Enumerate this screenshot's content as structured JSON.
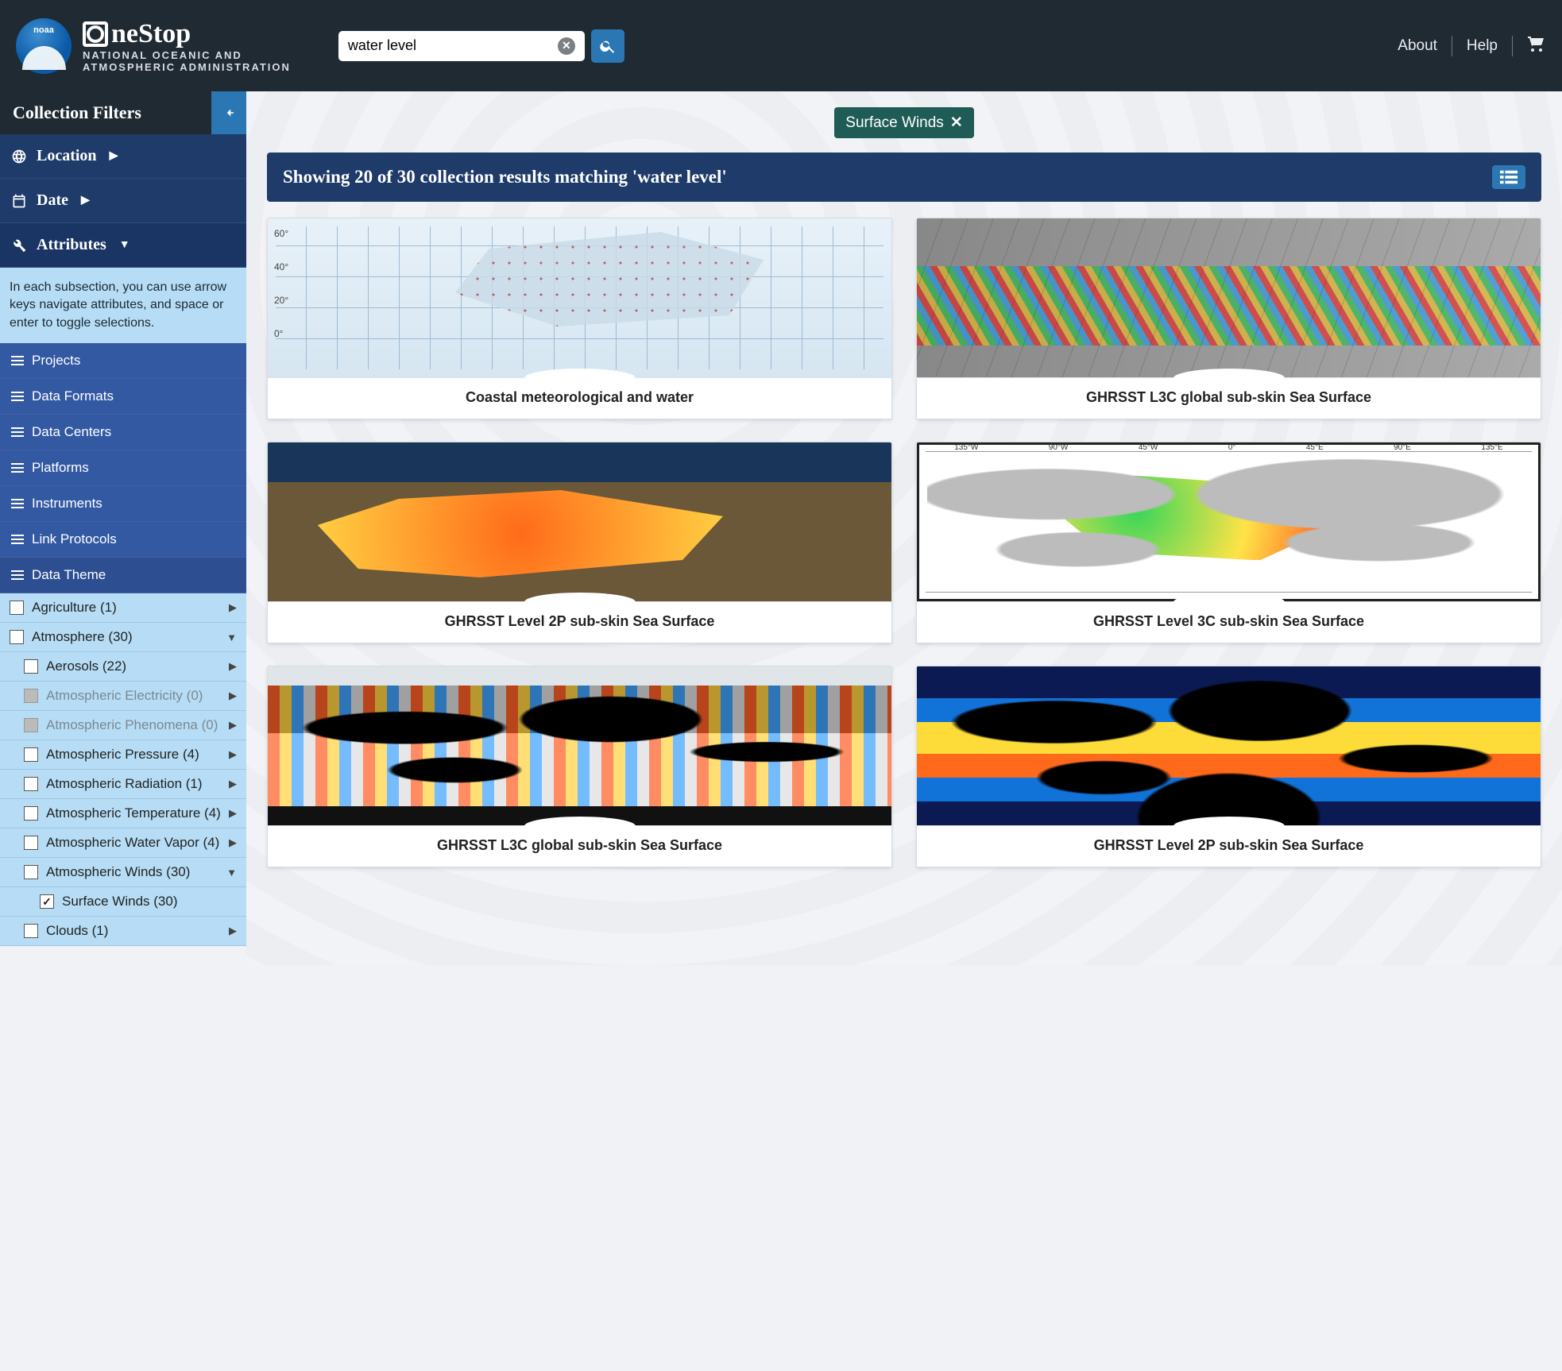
{
  "header": {
    "noaa_abbr": "noaa",
    "brand_name": "neStop",
    "brand_sub1": "NATIONAL OCEANIC AND",
    "brand_sub2": "ATMOSPHERIC ADMINISTRATION",
    "search_value": "water level",
    "links": {
      "about": "About",
      "help": "Help"
    }
  },
  "sidebar": {
    "title": "Collection Filters",
    "sections": {
      "location": "Location",
      "date": "Date",
      "attributes": "Attributes"
    },
    "help_text": "In each subsection, you can use arrow keys navigate attributes, and space or enter to toggle selections.",
    "subs": [
      "Projects",
      "Data Formats",
      "Data Centers",
      "Platforms",
      "Instruments",
      "Link Protocols",
      "Data Theme"
    ],
    "themes": [
      {
        "label": "Agriculture (1)",
        "level": 0,
        "checked": false,
        "disabled": false,
        "arrow": "▶"
      },
      {
        "label": "Atmosphere (30)",
        "level": 0,
        "checked": false,
        "disabled": false,
        "arrow": "▼"
      },
      {
        "label": "Aerosols (22)",
        "level": 1,
        "checked": false,
        "disabled": false,
        "arrow": "▶"
      },
      {
        "label": "Atmospheric Electricity (0)",
        "level": 1,
        "checked": false,
        "disabled": true,
        "arrow": "▶"
      },
      {
        "label": "Atmospheric Phenomena (0)",
        "level": 1,
        "checked": false,
        "disabled": true,
        "arrow": "▶"
      },
      {
        "label": "Atmospheric Pressure (4)",
        "level": 1,
        "checked": false,
        "disabled": false,
        "arrow": "▶"
      },
      {
        "label": "Atmospheric Radiation (1)",
        "level": 1,
        "checked": false,
        "disabled": false,
        "arrow": "▶"
      },
      {
        "label": "Atmospheric Temperature (4)",
        "level": 1,
        "checked": false,
        "disabled": false,
        "arrow": "▶"
      },
      {
        "label": "Atmospheric Water Vapor (4)",
        "level": 1,
        "checked": false,
        "disabled": false,
        "arrow": "▶"
      },
      {
        "label": "Atmospheric Winds (30)",
        "level": 1,
        "checked": false,
        "disabled": false,
        "arrow": "▼"
      },
      {
        "label": "Surface Winds (30)",
        "level": 2,
        "checked": true,
        "disabled": false,
        "arrow": ""
      },
      {
        "label": "Clouds (1)",
        "level": 1,
        "checked": false,
        "disabled": false,
        "arrow": "▶"
      }
    ]
  },
  "main": {
    "active_filter": "Surface Winds",
    "results_text": "Showing 20 of 30 collection results matching 'water level'",
    "cards": [
      {
        "title": "Coastal meteorological and water",
        "map": "map1"
      },
      {
        "title": "GHRSST L3C global sub-skin Sea Surface",
        "map": "map2"
      },
      {
        "title": "GHRSST Level 2P sub-skin Sea Surface",
        "map": "map3"
      },
      {
        "title": "GHRSST Level 3C sub-skin Sea Surface",
        "map": "map4"
      },
      {
        "title": "GHRSST L3C global sub-skin Sea Surface",
        "map": "map5"
      },
      {
        "title": "GHRSST Level 2P sub-skin Sea Surface",
        "map": "map6"
      }
    ],
    "map1_ticks": [
      "60°",
      "40°",
      "20°",
      "0°"
    ],
    "map4_ticks": [
      "135°W",
      "90°W",
      "45°W",
      "0°",
      "45°E",
      "90°E",
      "135°E"
    ]
  }
}
